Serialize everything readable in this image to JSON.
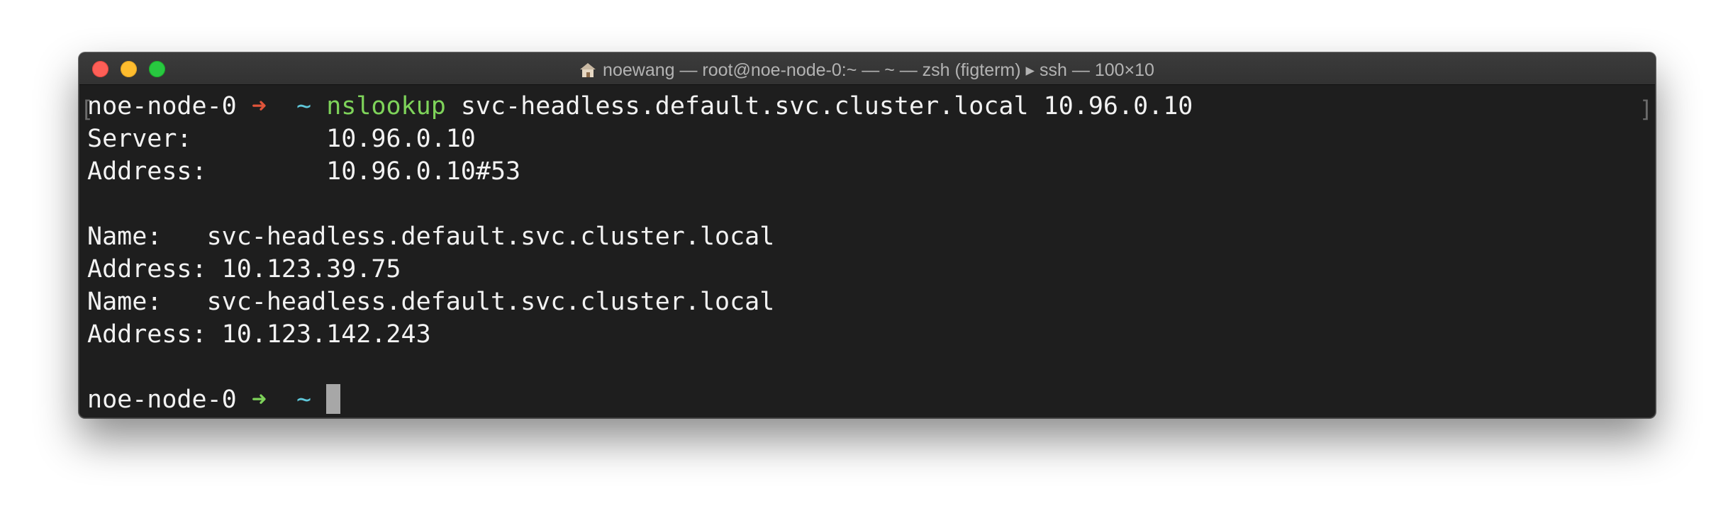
{
  "window": {
    "title": "noewang — root@noe-node-0:~ — ~ — zsh (figterm) ▸ ssh — 100×10",
    "home_icon": "home-icon"
  },
  "terminal": {
    "cmd_line": {
      "host": "noe-node-0",
      "arrow": "➜",
      "dir": "~",
      "command": "nslookup",
      "args": "svc-headless.default.svc.cluster.local 10.96.0.10"
    },
    "output": [
      "Server:         10.96.0.10",
      "Address:        10.96.0.10#53",
      "",
      "Name:   svc-headless.default.svc.cluster.local",
      "Address: 10.123.39.75",
      "Name:   svc-headless.default.svc.cluster.local",
      "Address: 10.123.142.243",
      ""
    ],
    "prompt_line": {
      "host": "noe-node-0",
      "arrow": "➜",
      "dir": "~"
    },
    "colors": {
      "background": "#1e1e1e",
      "text": "#f2f2f2",
      "error_arrow": "#e0543a",
      "success_arrow": "#7ed35a",
      "dir": "#5fc7d9",
      "command": "#7ed35a"
    }
  }
}
